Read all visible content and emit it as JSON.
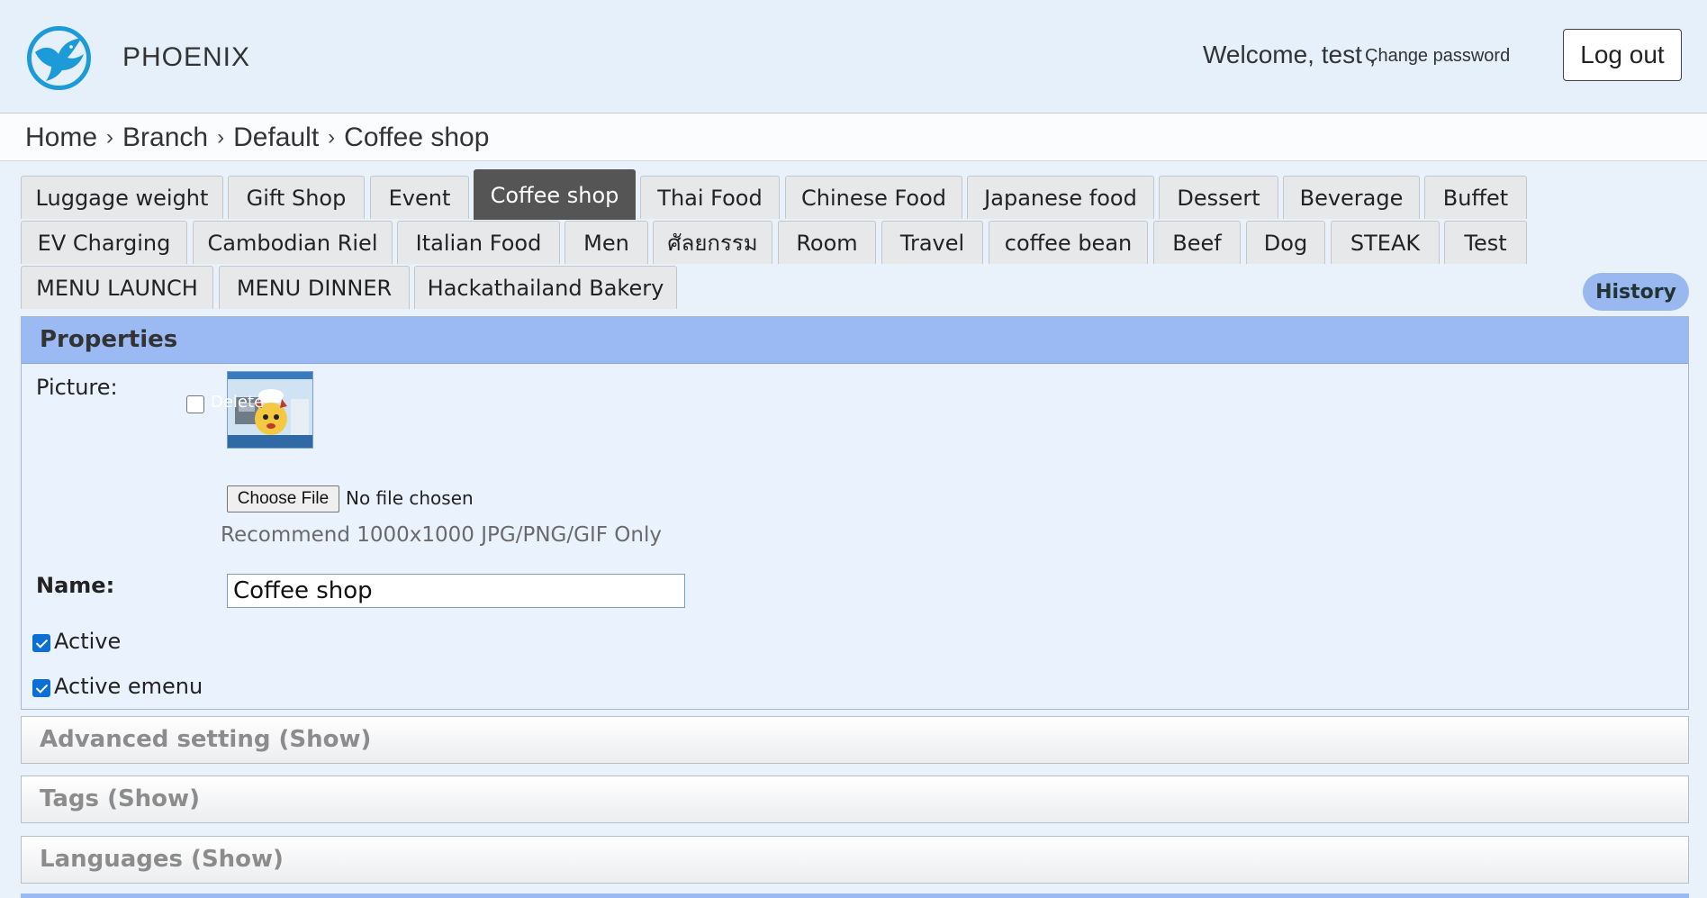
{
  "header": {
    "brand": "PHOENIX",
    "welcome": "Welcome, test",
    "separator": ",",
    "change_password": "Change password",
    "logout": "Log out"
  },
  "breadcrumb": [
    "Home",
    "Branch",
    "Default",
    "Coffee shop"
  ],
  "tabs": {
    "row1": [
      "Luggage weight",
      "Gift Shop",
      "Event",
      "Coffee shop",
      "Thai Food",
      "Chinese Food",
      "Japanese food",
      "Dessert",
      "Beverage",
      "Buffet"
    ],
    "row2": [
      "EV Charging",
      "Cambodian Riel",
      "Italian Food",
      "Men",
      "ศัลยกรรม",
      "Room",
      "Travel",
      "coffee bean",
      "Beef",
      "Dog",
      "STEAK",
      "Test"
    ],
    "row3": [
      "MENU LAUNCH",
      "MENU DINNER",
      "Hackathailand Bakery"
    ],
    "active": "Coffee shop"
  },
  "history_button": "History",
  "properties": {
    "title": "Properties",
    "picture_label": "Picture:",
    "delete_label": "Delete",
    "choose_file": "Choose File",
    "no_file": "No file chosen",
    "recommend": "Recommend 1000x1000 JPG/PNG/GIF Only",
    "name_label": "Name:",
    "name_value": "Coffee shop",
    "active_label": "Active",
    "active_checked": true,
    "active_emenu_label": "Active emenu",
    "active_emenu_checked": true
  },
  "sections": [
    "Advanced setting (Show)",
    "Tags (Show)",
    "Languages (Show)"
  ],
  "colors": {
    "accent": "#9bbaf3",
    "active_tab": "#555555",
    "checkbox": "#0b6fd6",
    "logo": "#1d9bd9"
  }
}
